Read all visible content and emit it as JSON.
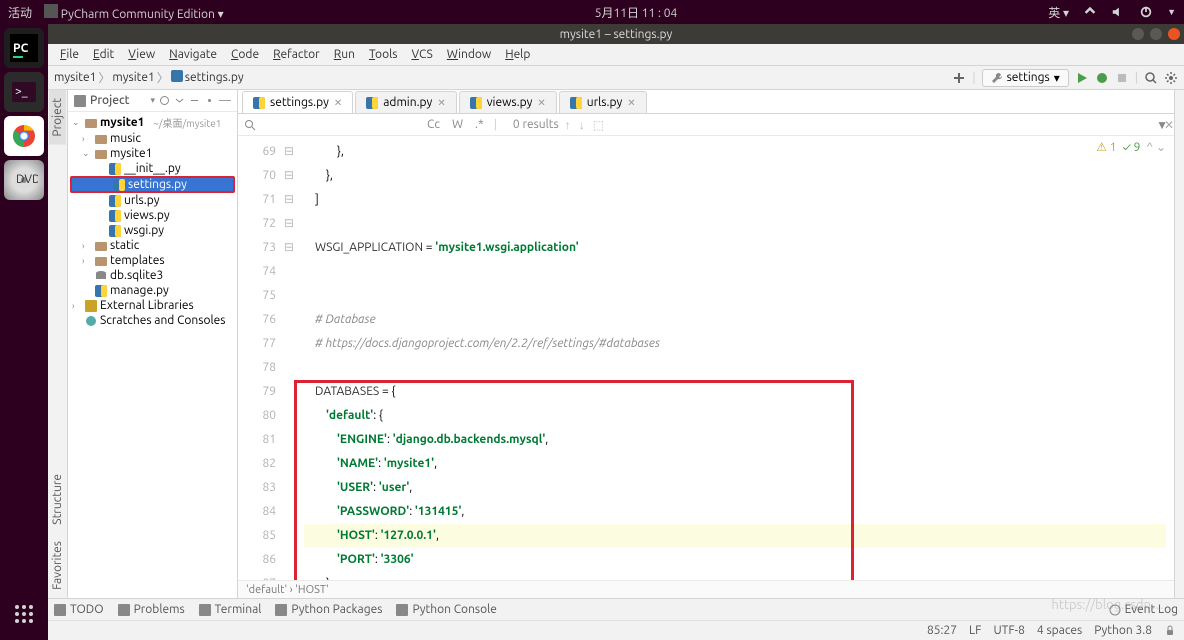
{
  "system": {
    "activities": "活动",
    "app_indicator": "PyCharm Community Edition ▾",
    "clock": "5月11日  11 : 04",
    "input_method": "英 ▾"
  },
  "window": {
    "title": "mysite1 – settings.py"
  },
  "menu": [
    "File",
    "Edit",
    "View",
    "Navigate",
    "Code",
    "Refactor",
    "Run",
    "Tools",
    "VCS",
    "Window",
    "Help"
  ],
  "breadcrumb": [
    "mysite1",
    "mysite1",
    "settings.py"
  ],
  "run_config": {
    "hammer": "⚙",
    "label": "settings",
    "dropdown": "▾"
  },
  "project": {
    "header": "Project",
    "root": {
      "name": "mysite1",
      "hint": "~/桌面/mysite1"
    },
    "items": [
      {
        "depth": 1,
        "arrow": "›",
        "icon": "folder",
        "label": "music"
      },
      {
        "depth": 1,
        "arrow": "⌄",
        "icon": "folder",
        "label": "mysite1"
      },
      {
        "depth": 2,
        "arrow": "",
        "icon": "py",
        "label": "__init__.py"
      },
      {
        "depth": 2,
        "arrow": "",
        "icon": "py",
        "label": "settings.py",
        "selected": true
      },
      {
        "depth": 2,
        "arrow": "",
        "icon": "py",
        "label": "urls.py"
      },
      {
        "depth": 2,
        "arrow": "",
        "icon": "py",
        "label": "views.py"
      },
      {
        "depth": 2,
        "arrow": "",
        "icon": "py",
        "label": "wsgi.py"
      },
      {
        "depth": 1,
        "arrow": "›",
        "icon": "folder",
        "label": "static"
      },
      {
        "depth": 1,
        "arrow": "›",
        "icon": "folder",
        "label": "templates"
      },
      {
        "depth": 1,
        "arrow": "",
        "icon": "db",
        "label": "db.sqlite3"
      },
      {
        "depth": 1,
        "arrow": "",
        "icon": "py",
        "label": "manage.py"
      },
      {
        "depth": 0,
        "arrow": "›",
        "icon": "lib",
        "label": "External Libraries"
      },
      {
        "depth": 0,
        "arrow": "",
        "icon": "scratch",
        "label": "Scratches and Consoles"
      }
    ]
  },
  "tabs": [
    {
      "label": "settings.py",
      "active": true
    },
    {
      "label": "admin.py"
    },
    {
      "label": "views.py"
    },
    {
      "label": "urls.py"
    }
  ],
  "search": {
    "placeholder": "",
    "opts": [
      "Cc",
      "W",
      ".*"
    ],
    "results": "0 results"
  },
  "inspection": {
    "warn": "⚠ 1",
    "ok": "✓ 9",
    "nav": "^ ⌄"
  },
  "gutter_start": 69,
  "code_lines": [
    "            },",
    "        },",
    "    ]",
    "",
    "    WSGI_APPLICATION = 'mysite1.wsgi.application'",
    "",
    "",
    "    # Database",
    "    # https://docs.djangoproject.com/en/2.2/ref/settings/#databases",
    "",
    "    DATABASES = {",
    "        'default': {",
    "            'ENGINE': 'django.db.backends.mysql',",
    "            'NAME': 'mysite1',",
    "            'USER': 'user',",
    "            'PASSWORD': '131415',",
    "            'HOST': '127.0.0.1',",
    "            'PORT': '3306'",
    "        }",
    "    }"
  ],
  "highlighted_line_index": 16,
  "crumb_path": "'default'  ›  'HOST'",
  "bottom_tools": [
    "TODO",
    "Problems",
    "Terminal",
    "Python Packages",
    "Python Console"
  ],
  "event_log": "Event Log",
  "status": {
    "pos": "85:27",
    "le": "LF",
    "enc": "UTF-8",
    "indent": "4 spaces",
    "interp": "Python 3.8"
  },
  "leftbar": {
    "project": "Project",
    "structure": "Structure",
    "favorites": "Favorites"
  },
  "colors": {
    "accent": "#3874d1",
    "highlight_box": "#d23"
  }
}
